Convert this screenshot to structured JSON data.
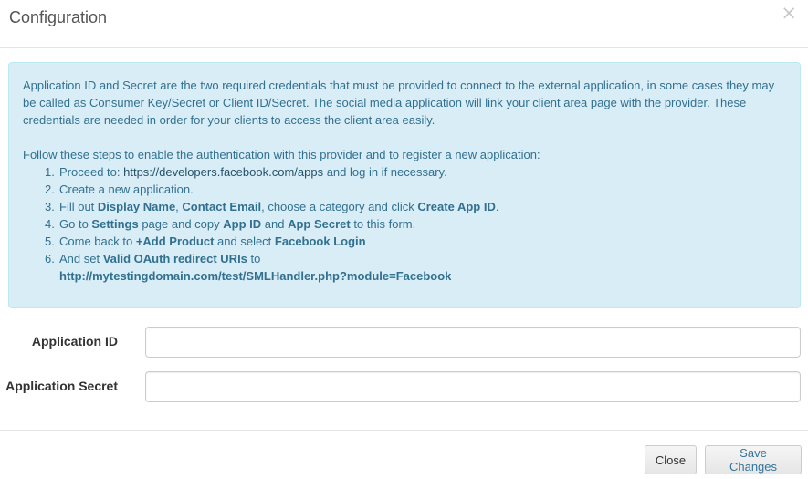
{
  "modal": {
    "title": "Configuration",
    "close_symbol": "×"
  },
  "info": {
    "paragraph": "Application ID and Secret are the two required credentials that must be provided to connect to the external application, in some cases they may be called as Consumer Key/Secret or Client ID/Secret. The social media application will link your client area page with the provider. These credentials are needed in order for your clients to access the client area easily.",
    "steps_intro": "Follow these steps to enable the authentication with this provider and to register a new application:",
    "steps": [
      {
        "num": "1.",
        "a": "Proceed to: ",
        "link": "https://developers.facebook.com/apps",
        "b": " and log in if necessary."
      },
      {
        "num": "2.",
        "a": "Create a new application."
      },
      {
        "num": "3.",
        "a": "Fill out ",
        "b1": "Display Name",
        "c": ", ",
        "b2": "Contact Email",
        "d": ", choose a category and click ",
        "b3": "Create App ID",
        "e": "."
      },
      {
        "num": "4.",
        "a": "Go to ",
        "b1": "Settings",
        "c": " page and copy ",
        "b2": "App ID",
        "d": " and ",
        "b3": "App Secret",
        "e": " to this form."
      },
      {
        "num": "5.",
        "a": "Come back to ",
        "b1": "+Add Product",
        "c": " and select ",
        "b2": "Facebook Login"
      },
      {
        "num": "6.",
        "a": "And set ",
        "b1": "Valid OAuth redirect URIs",
        "c": " to",
        "b2": "http://mytestingdomain.com/test/SMLHandler.php?module=Facebook"
      }
    ]
  },
  "form": {
    "app_id_label": "Application ID",
    "app_id_value": "",
    "app_secret_label": "Application Secret",
    "app_secret_value": ""
  },
  "footer": {
    "close_label": "Close",
    "save_label": "Save Changes"
  }
}
